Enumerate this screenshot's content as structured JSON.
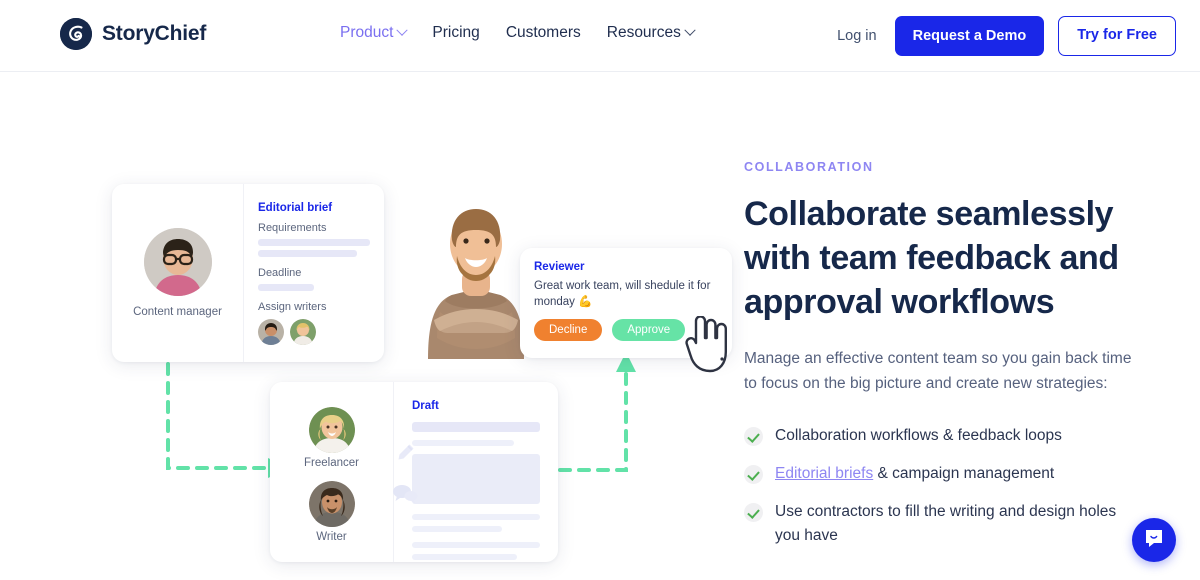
{
  "header": {
    "brand": "StoryChief",
    "brand_icon": "storychief-logo-icon",
    "nav": [
      {
        "label": "Product",
        "has_caret": true,
        "active": true
      },
      {
        "label": "Pricing",
        "has_caret": false,
        "active": false
      },
      {
        "label": "Customers",
        "has_caret": false,
        "active": false
      },
      {
        "label": "Resources",
        "has_caret": true,
        "active": false
      }
    ],
    "login_label": "Log in",
    "demo_label": "Request a Demo",
    "trial_label": "Try for Free",
    "accent_blue": "#1a27e8",
    "nav_active_color": "#7a6ff0",
    "nav_color": "#1f2d4e"
  },
  "copy": {
    "eyebrow": "COLLABORATION",
    "headline": "Collaborate seamlessly with team feedback and approval workflows",
    "lede": "Manage an effective content team so you gain back time to focus on the big picture and create new strategies:",
    "bullets": [
      {
        "prefix": "",
        "link": "",
        "text": "Collaboration workflows & feedback loops"
      },
      {
        "prefix": "",
        "link": "Editorial briefs",
        "text": " & campaign management"
      },
      {
        "prefix": "",
        "link": "",
        "text": "Use contractors to fill the writing and design holes you have"
      }
    ],
    "eyebrow_color": "#8e86f2",
    "link_color": "#8e86f2",
    "check_color": "#4caf50"
  },
  "illustration": {
    "brief_card": {
      "role_label": "Content manager",
      "avatar_name": "content-manager-avatar",
      "title": "Editorial brief",
      "requirements_label": "Requirements",
      "deadline_label": "Deadline",
      "assign_label": "Assign writers",
      "writer_avatars": [
        "writer-avatar-1",
        "writer-avatar-2"
      ]
    },
    "reviewer_card": {
      "title": "Reviewer",
      "message": "Great work team, will shedule it for monday 💪",
      "decline_label": "Decline",
      "approve_label": "Approve",
      "decline_color": "#f0812f",
      "approve_color": "#66e3a6"
    },
    "draft_card": {
      "title": "Draft",
      "roles": [
        {
          "label": "Freelancer",
          "avatar_name": "freelancer-avatar"
        },
        {
          "label": "Writer",
          "avatar_name": "writer-avatar"
        }
      ],
      "mini_icons": [
        "pencil-icon",
        "comment-icon"
      ]
    },
    "person_name": "reviewer-person-photo",
    "cursor_name": "hand-cursor-icon",
    "connector_color": "#62e2a8"
  },
  "chat": {
    "icon": "chat-bubble-icon",
    "color": "#1a27e8"
  }
}
